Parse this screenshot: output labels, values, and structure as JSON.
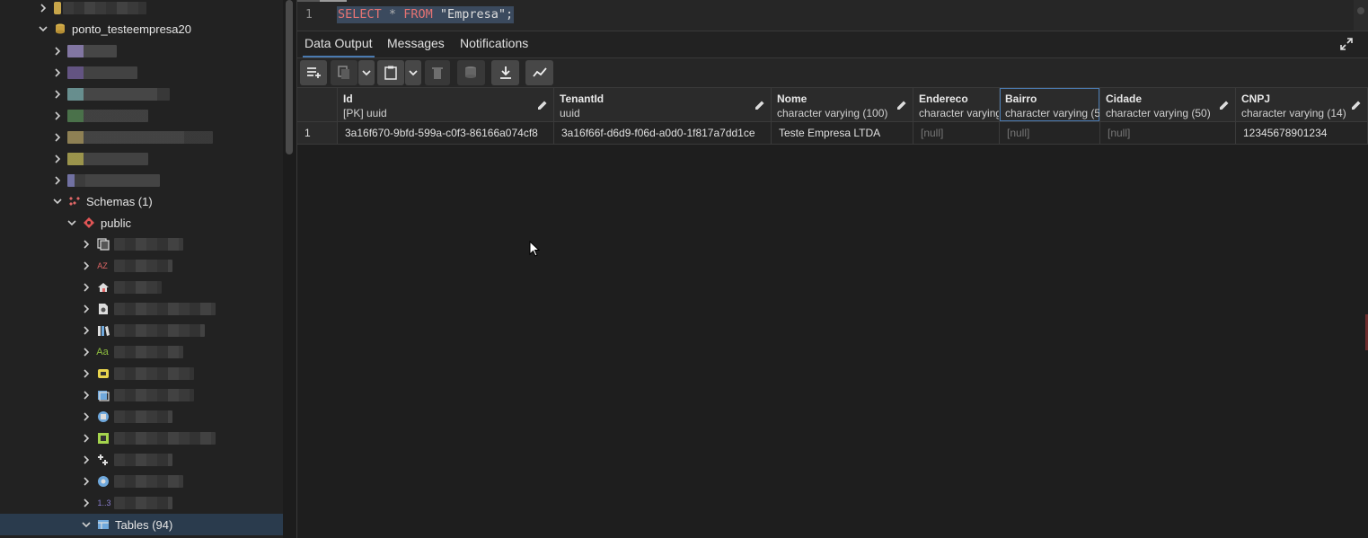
{
  "sidebar": {
    "database_name": "ponto_testeempresa20",
    "schemas_label": "Schemas (1)",
    "schema_public": "public",
    "tables_label": "Tables (94)"
  },
  "editor": {
    "line_number": "1",
    "sql_keyword_select": "SELECT",
    "sql_star": "*",
    "sql_keyword_from": "FROM",
    "sql_table": "\"Empresa\";"
  },
  "result_tabs": [
    "Data Output",
    "Messages",
    "Notifications"
  ],
  "grid": {
    "columns": [
      {
        "name": "Id",
        "type": "[PK] uuid"
      },
      {
        "name": "TenantId",
        "type": "uuid"
      },
      {
        "name": "Nome",
        "type": "character varying (100)"
      },
      {
        "name": "Endereco",
        "type": "character varying"
      },
      {
        "name": "Bairro",
        "type": "character varying (5"
      },
      {
        "name": "Cidade",
        "type": "character varying (50)"
      },
      {
        "name": "CNPJ",
        "type": "character varying (14)"
      }
    ],
    "rows": [
      {
        "num": "1",
        "cells": [
          "3a16f670-9bfd-599a-c0f3-86166a074cf8",
          "3a16f66f-d6d9-f06d-a0d0-1f817a7dd1ce",
          "Teste Empresa LTDA",
          "[null]",
          "[null]",
          "[null]",
          "12345678901234"
        ]
      }
    ]
  },
  "colors": {
    "keyword": "#e57373",
    "selection": "#3b4a5e",
    "accent": "#4a7ab0"
  }
}
